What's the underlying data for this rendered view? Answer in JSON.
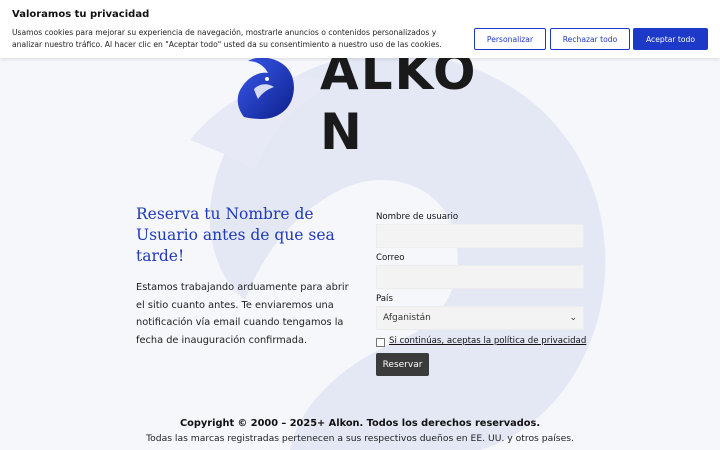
{
  "cookie_banner": {
    "title": "Valoramos tu privacidad",
    "text": "Usamos cookies para mejorar su experiencia de navegación, mostrarle anuncios o contenidos personalizados y analizar nuestro tráfico. Al hacer clic en \"Aceptar todo\" usted da su consentimiento a nuestro uso de las cookies.",
    "customize_label": "Personalizar",
    "reject_label": "Rechazar todo",
    "accept_label": "Aceptar todo"
  },
  "brand": {
    "name": "ALKON",
    "logo_icon": "eagle-head-icon",
    "color": "#1c39c7"
  },
  "intro": {
    "heading": "Reserva tu Nombre de Usuario antes de que sea tarde!",
    "body": "Estamos trabajando arduamente para abrir el sitio cuanto antes. Te enviaremos una notificación vía email cuando tengamos la fecha de inauguración confirmada."
  },
  "form": {
    "username_label": "Nombre de usuario",
    "username_value": "",
    "email_label": "Correo",
    "email_value": "",
    "country_label": "País",
    "country_value": "Afganistán",
    "consent_label": "Si continúas, aceptas la política de privacidad",
    "consent_checked": false,
    "submit_label": "Reservar"
  },
  "footer": {
    "copyright": "Copyright © 2000 – 2025+ Alkon. Todos los derechos reservados.",
    "trademark": "Todas las marcas registradas pertenecen a sus respectivos dueños en EE. UU. y otros países."
  }
}
